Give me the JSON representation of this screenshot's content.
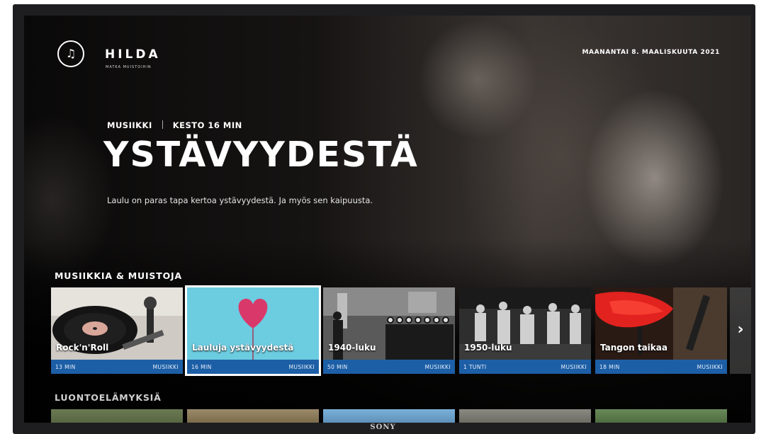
{
  "header": {
    "brand": "HILDA",
    "tagline": "MATKA MUISTOIHIN",
    "date": "MAANANTAI 8. MAALISKUUTA 2021"
  },
  "hero": {
    "category": "MUSIIKKI",
    "duration": "KESTO 16 MIN",
    "title": "YSTÄVYYDESTÄ",
    "description": "Laulu on paras tapa kertoa ystävyydestä. Ja myös sen kaipuusta."
  },
  "rows": [
    {
      "title": "MUSIIKKIA & MUISTOJA",
      "cards": [
        {
          "name": "Rock'n'Roll",
          "duration": "13 MIN",
          "category": "MUSIIKKI",
          "image": "vinyl-record-player"
        },
        {
          "name": "Lauluja ystävyydestä",
          "duration": "16 MIN",
          "category": "MUSIIKKI",
          "image": "heart-balloon",
          "selected": true
        },
        {
          "name": "1940-luku",
          "duration": "50 MIN",
          "category": "MUSIIKKI",
          "image": "vintage-choir-photo"
        },
        {
          "name": "1950-luku",
          "duration": "1 TUNTI",
          "category": "MUSIIKKI",
          "image": "vintage-dance-photo"
        },
        {
          "name": "Tangon taikaa",
          "duration": "18 MIN",
          "category": "MUSIIKKI",
          "image": "tango-red-dress"
        }
      ]
    },
    {
      "title": "LUONTOELÄMYKSIÄ",
      "cards": []
    }
  ],
  "device": {
    "brand": "SONY"
  },
  "colors": {
    "accent_bar": "#1d5fa6",
    "background": "#0b0a0a",
    "text": "#ffffff"
  }
}
